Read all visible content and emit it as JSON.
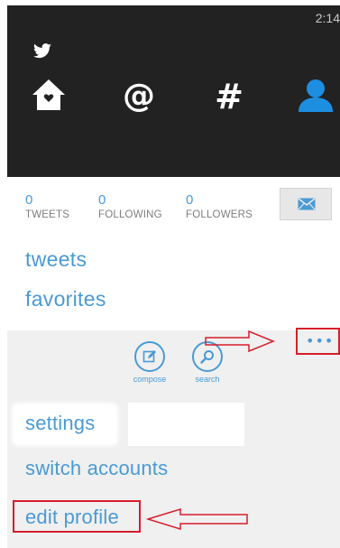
{
  "status_bar": {
    "time": "2:14"
  },
  "nav": {
    "bird_icon": "twitter-bird-icon",
    "items": [
      {
        "name": "home",
        "icon": "home-icon"
      },
      {
        "name": "mentions",
        "icon": "at-icon"
      },
      {
        "name": "hashtag",
        "icon": "hashtag-icon"
      },
      {
        "name": "profile",
        "icon": "profile-icon",
        "active": true
      }
    ]
  },
  "stats": {
    "tweets": {
      "count": "0",
      "label": "TWEETS"
    },
    "following": {
      "count": "0",
      "label": "FOLLOWING"
    },
    "followers": {
      "count": "0",
      "label": "FOLLOWERS"
    }
  },
  "message_button": {
    "icon": "envelope-icon"
  },
  "links": {
    "tweets": "tweets",
    "favorites": "favorites"
  },
  "appbar": {
    "buttons": [
      {
        "label": "compose",
        "icon": "compose-icon"
      },
      {
        "label": "search",
        "icon": "search-icon"
      }
    ],
    "more": "•••",
    "menu": {
      "settings": "settings",
      "switch_accounts": "switch accounts",
      "edit_profile": "edit profile"
    }
  },
  "colors": {
    "accent": "#4a9ad4",
    "header_bg": "#222222",
    "appbar_bg": "#f0f0f0",
    "annotation": "#d61e2c"
  }
}
